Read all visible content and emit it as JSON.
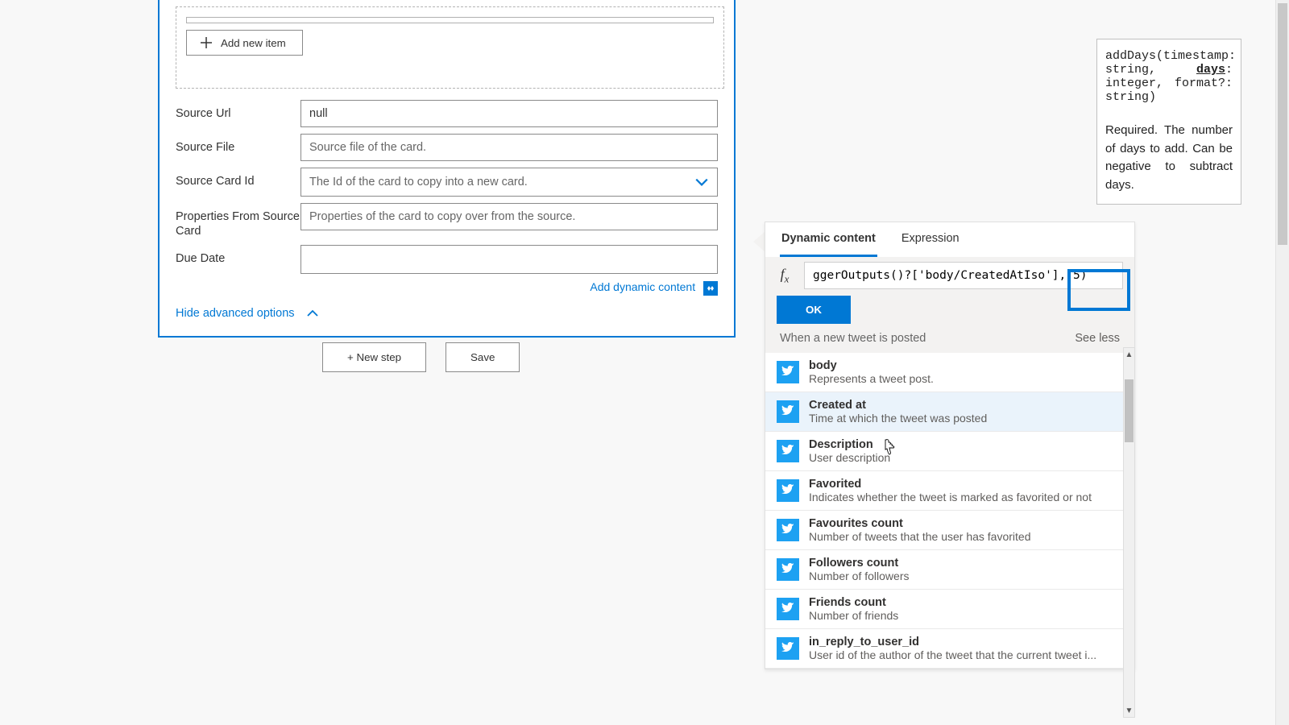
{
  "card": {
    "add_item_label": "Add new item",
    "fields": {
      "source_url": {
        "label": "Source Url",
        "value": "null"
      },
      "source_file": {
        "label": "Source File",
        "placeholder": "Source file of the card."
      },
      "source_card_id": {
        "label": "Source Card Id",
        "placeholder": "The Id of the card to copy into a new card."
      },
      "props_from_source": {
        "label": "Properties From Source Card",
        "placeholder": "Properties of the card to copy over from the source."
      },
      "due_date": {
        "label": "Due Date",
        "value": ""
      }
    },
    "add_dynamic": "Add dynamic content",
    "advanced": "Hide advanced options"
  },
  "buttons": {
    "new_step": "+ New step",
    "save": "Save"
  },
  "dc": {
    "tab_dynamic": "Dynamic content",
    "tab_expression": "Expression",
    "fx_value": "ggerOutputs()?['body/CreatedAtIso'], 5)",
    "ok": "OK",
    "section_title": "When a new tweet is posted",
    "see_less": "See less",
    "items": [
      {
        "title": "body",
        "desc": "Represents a tweet post."
      },
      {
        "title": "Created at",
        "desc": "Time at which the tweet was posted"
      },
      {
        "title": "Description",
        "desc": "User description"
      },
      {
        "title": "Favorited",
        "desc": "Indicates whether the tweet is marked as favorited or not"
      },
      {
        "title": "Favourites count",
        "desc": "Number of tweets that the user has favorited"
      },
      {
        "title": "Followers count",
        "desc": "Number of followers"
      },
      {
        "title": "Friends count",
        "desc": "Number of friends"
      },
      {
        "title": "in_reply_to_user_id",
        "desc": "User id of the author of the tweet that the current tweet i..."
      }
    ]
  },
  "tooltip": {
    "sig_pre": "addDays(timestamp: string, ",
    "sig_arg": "days",
    "sig_post": ": integer, format?: string)",
    "desc": "Required. The number of days to add. Can be negative to subtract days."
  }
}
